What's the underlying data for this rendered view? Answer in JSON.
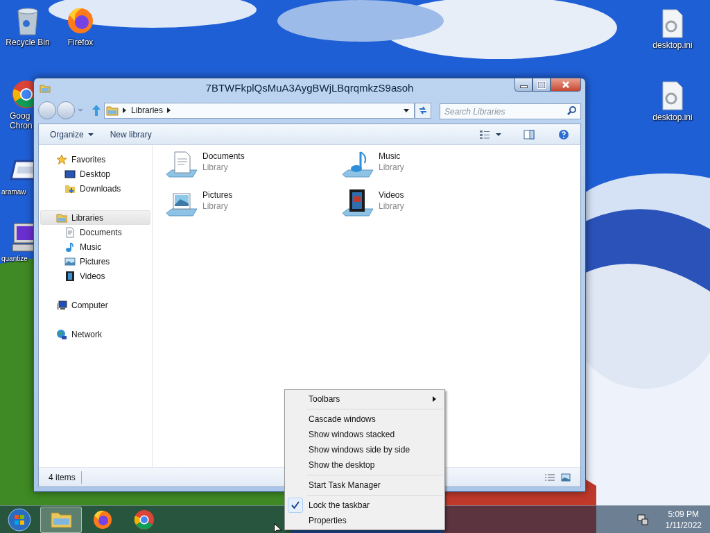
{
  "desktop_icons": [
    {
      "lines": [
        "Recycle Bin"
      ]
    },
    {
      "lines": [
        "Firefox"
      ]
    },
    {
      "lines": [
        "Goog",
        "Chron"
      ]
    },
    {
      "lines": [
        "aramaw"
      ]
    },
    {
      "lines": [
        "quantize"
      ]
    },
    {
      "lines": [
        "desktop.ini"
      ]
    },
    {
      "lines": [
        "desktop.ini"
      ]
    }
  ],
  "window": {
    "title": "7BTWFkplQsMuA3AygBWjLBqrqmkzS9asoh",
    "address": "Libraries",
    "search": {
      "placeholder": "Search Libraries"
    },
    "toolbar": [
      "Organize",
      "New library"
    ],
    "nav": [
      {
        "label": "Favorites",
        "selected": false,
        "children": [
          {
            "label": "Desktop",
            "selected": false
          },
          {
            "label": "Downloads",
            "selected": false
          }
        ]
      },
      {
        "label": "Libraries",
        "selected": true,
        "children": [
          {
            "label": "Documents",
            "selected": false
          },
          {
            "label": "Music",
            "selected": false
          },
          {
            "label": "Pictures",
            "selected": false
          },
          {
            "label": "Videos",
            "selected": false
          }
        ]
      },
      {
        "label": "Computer",
        "selected": false
      },
      {
        "label": "Network",
        "selected": false
      }
    ],
    "items": [
      {
        "name": "Documents",
        "type": "Library"
      },
      {
        "name": "Music",
        "type": "Library"
      },
      {
        "name": "Pictures",
        "type": "Library"
      },
      {
        "name": "Videos",
        "type": "Library"
      }
    ],
    "status_bar": "4 items"
  },
  "context_menu": [
    {
      "kind": "item",
      "label": "Toolbars",
      "submenu": true,
      "checked": false
    },
    {
      "kind": "separator"
    },
    {
      "kind": "item",
      "label": "Cascade windows",
      "submenu": false,
      "checked": false
    },
    {
      "kind": "item",
      "label": "Show windows stacked",
      "submenu": false,
      "checked": false
    },
    {
      "kind": "item",
      "label": "Show windows side by side",
      "submenu": false,
      "checked": false
    },
    {
      "kind": "item",
      "label": "Show the desktop",
      "submenu": false,
      "checked": false
    },
    {
      "kind": "separator"
    },
    {
      "kind": "item",
      "label": "Start Task Manager",
      "submenu": false,
      "checked": false
    },
    {
      "kind": "separator"
    },
    {
      "kind": "item",
      "label": "Lock the taskbar",
      "submenu": false,
      "checked": true
    },
    {
      "kind": "item",
      "label": "Properties",
      "submenu": false,
      "checked": false
    }
  ],
  "taskbar": {
    "apps": [
      {
        "selected": true
      },
      {
        "selected": false
      },
      {
        "selected": false
      }
    ],
    "time": "5:09 PM",
    "date": "1/11/2022"
  }
}
